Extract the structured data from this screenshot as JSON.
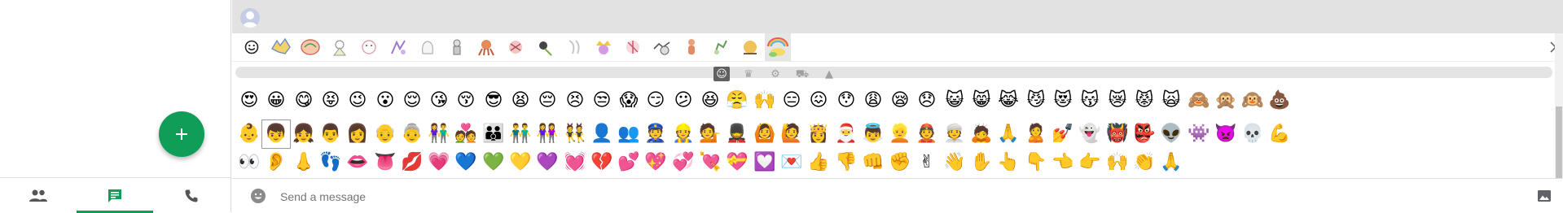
{
  "left_pane": {
    "fab": {
      "icon": "plus-icon",
      "color": "#0f9d58"
    },
    "nav_tabs": [
      {
        "icon": "people-icon",
        "active": false
      },
      {
        "icon": "chat-icon",
        "active": true
      },
      {
        "icon": "phone-icon",
        "active": false
      }
    ],
    "accent": "#0f9d58"
  },
  "header": {
    "avatar_icon": "person-avatar-icon"
  },
  "sticker_strip": {
    "first_icon": "smiley-outline-icon",
    "sticker_count": 16,
    "selected_index": 15,
    "next_icon": "chevron-right-icon"
  },
  "emoji_categories": [
    {
      "icon": "smiley-icon",
      "glyph": "☺",
      "active": true
    },
    {
      "icon": "crown-icon",
      "glyph": "♛",
      "active": false
    },
    {
      "icon": "gear-icon",
      "glyph": "⚙",
      "active": false
    },
    {
      "icon": "car-icon",
      "glyph": "⛟",
      "active": false
    },
    {
      "icon": "triangle-icon",
      "glyph": "▲",
      "active": false
    }
  ],
  "emoji_rows": [
    [
      "😍",
      "😀",
      "😋",
      "😝",
      "😉",
      "😮",
      "😌",
      "😘",
      "😚",
      "😎",
      "😫",
      "😔",
      "😣",
      "😒",
      "😱",
      "😏",
      "😕",
      "😆",
      "😤",
      "🙌",
      "😑",
      "😖",
      "😯",
      "😩",
      "😪",
      "😞",
      "😺",
      "😸",
      "😹",
      "😼",
      "😻",
      "😽",
      "😿",
      "😾",
      "🙀",
      "🙈",
      "🙊",
      "🙉",
      "💩"
    ],
    [
      "👶",
      "👦",
      "👧",
      "👨",
      "👩",
      "👴",
      "👵",
      "👫",
      "💑",
      "👪",
      "👬",
      "👭",
      "👯",
      "👤",
      "👥",
      "👮",
      "👷",
      "💁",
      "💂",
      "🙆",
      "🙋",
      "👸",
      "🎅",
      "👼",
      "👱",
      "👲",
      "👳",
      "🙇",
      "🙏",
      "🙎",
      "💅",
      "👻",
      "👹",
      "👺",
      "👽",
      "👾",
      "👿",
      "💀",
      "💪"
    ],
    [
      "👀",
      "👂",
      "👃",
      "👣",
      "👄",
      "👅",
      "💋",
      "💗",
      "💙",
      "💚",
      "💛",
      "💜",
      "💓",
      "💔",
      "💕",
      "💖",
      "💞",
      "💘",
      "💝",
      "💟",
      "💌",
      "👍",
      "👎",
      "👊",
      "✊",
      "✌",
      "👋",
      "✋",
      "👆",
      "👇",
      "👈",
      "👉",
      "🙌",
      "👏",
      "🙏"
    ]
  ],
  "selected_emoji": {
    "row": 1,
    "col": 1
  },
  "composer": {
    "emoji_icon": "smiley-button-icon",
    "placeholder": "Send a message",
    "image_icon": "image-icon"
  }
}
